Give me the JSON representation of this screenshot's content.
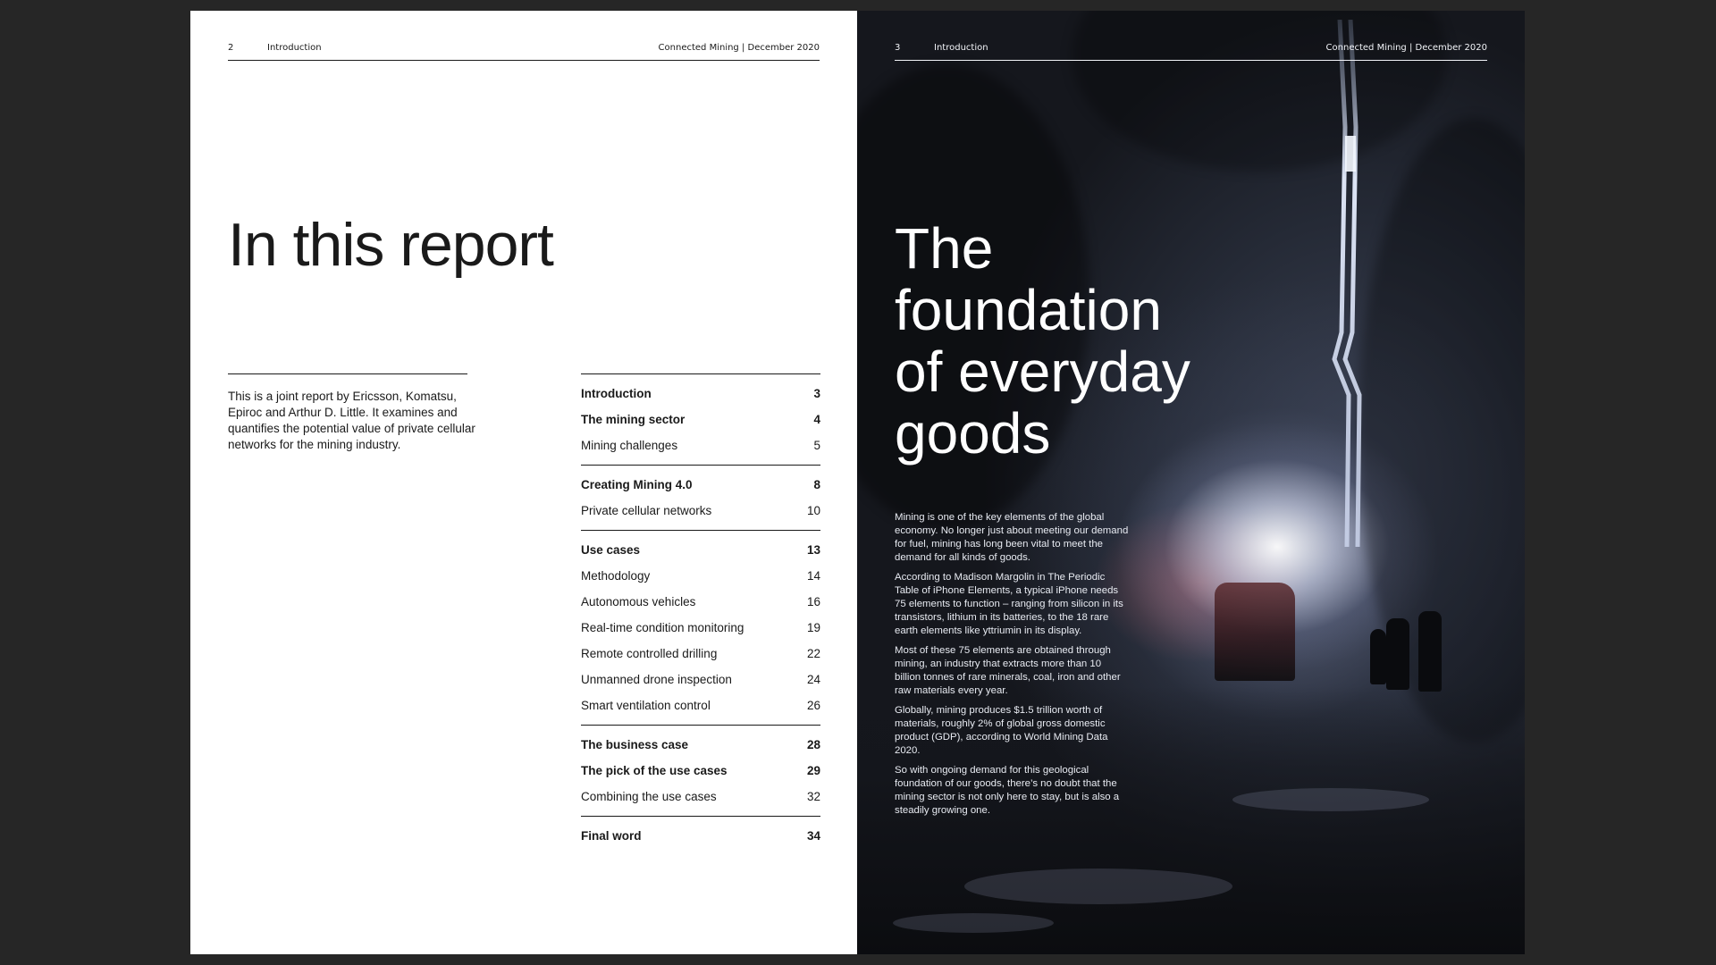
{
  "left_page": {
    "page_number": "2",
    "section": "Introduction",
    "publication": "Connected Mining | December 2020",
    "title": "In this report",
    "intro": "This is a joint report by Ericsson, Komatsu, Epiroc and Arthur D. Little. It examines and quantifies the potential value of private cellular networks for the mining industry.",
    "toc": [
      {
        "items": [
          {
            "label": "Introduction",
            "page": "3",
            "bold": true
          },
          {
            "label": "The mining sector",
            "page": "4",
            "bold": true
          },
          {
            "label": "Mining challenges",
            "page": "5",
            "bold": false
          }
        ]
      },
      {
        "items": [
          {
            "label": "Creating Mining 4.0",
            "page": "8",
            "bold": true
          },
          {
            "label": "Private cellular networks",
            "page": "10",
            "bold": false
          }
        ]
      },
      {
        "items": [
          {
            "label": "Use cases",
            "page": "13",
            "bold": true
          },
          {
            "label": "Methodology",
            "page": "14",
            "bold": false
          },
          {
            "label": "Autonomous vehicles",
            "page": "16",
            "bold": false
          },
          {
            "label": "Real-time condition monitoring",
            "page": "19",
            "bold": false
          },
          {
            "label": "Remote controlled drilling",
            "page": "22",
            "bold": false
          },
          {
            "label": "Unmanned drone inspection",
            "page": "24",
            "bold": false
          },
          {
            "label": "Smart ventilation control",
            "page": "26",
            "bold": false
          }
        ]
      },
      {
        "items": [
          {
            "label": "The business case",
            "page": "28",
            "bold": true
          },
          {
            "label": "The pick of the use cases",
            "page": "29",
            "bold": true
          },
          {
            "label": "Combining the use cases",
            "page": "32",
            "bold": false
          }
        ]
      },
      {
        "items": [
          {
            "label": "Final word",
            "page": "34",
            "bold": true
          }
        ]
      }
    ]
  },
  "right_page": {
    "page_number": "3",
    "section": "Introduction",
    "publication": "Connected Mining | December 2020",
    "title": "The foundation of everyday goods",
    "paragraphs": [
      "Mining is one of the key elements of the global economy. No longer just about meeting our demand for fuel, mining has long been vital to meet the demand for all kinds of goods.",
      "According to Madison Margolin in The Periodic Table of iPhone Elements, a typical iPhone needs 75 elements to function – ranging from silicon in its transistors, lithium in its batteries, to the 18 rare earth elements like yttriumin in its display.",
      "Most of these 75 elements are obtained through mining, an industry that extracts more than 10 billion tonnes of rare minerals, coal, iron and other raw materials every year.",
      "Globally, mining produces $1.5 trillion worth of materials, roughly 2% of global gross domestic product (GDP), according to World Mining Data 2020.",
      "So with ongoing demand for this geological foundation of our goods, there’s no doubt that the mining sector is not only here to stay, but is also a steadily growing one."
    ]
  }
}
